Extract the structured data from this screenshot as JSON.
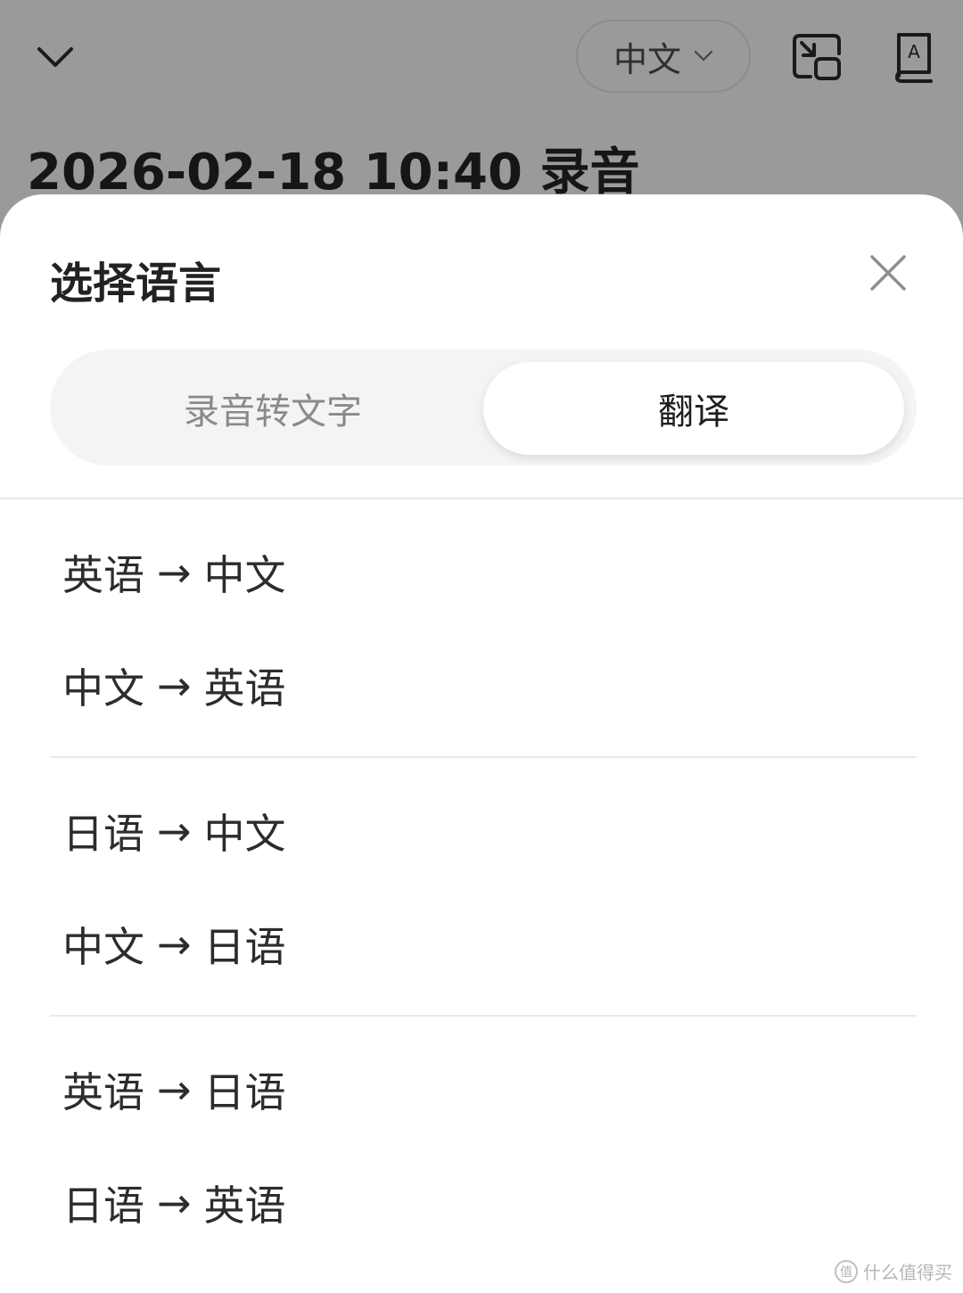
{
  "header": {
    "language_selector": "中文",
    "recording_title": "2026-02-18 10:40 录音"
  },
  "sheet": {
    "title": "选择语言",
    "tabs": [
      {
        "label": "录音转文字",
        "selected": false
      },
      {
        "label": "翻译",
        "selected": true
      }
    ],
    "arrow_glyph": "→",
    "groups": [
      {
        "items": [
          {
            "from": "英语",
            "to": "中文"
          },
          {
            "from": "中文",
            "to": "英语"
          }
        ]
      },
      {
        "items": [
          {
            "from": "日语",
            "to": "中文"
          },
          {
            "from": "中文",
            "to": "日语"
          }
        ]
      },
      {
        "items": [
          {
            "from": "英语",
            "to": "日语"
          },
          {
            "from": "日语",
            "to": "英语"
          }
        ]
      }
    ]
  },
  "watermark": {
    "icon_char": "值",
    "text": "什么值得买"
  },
  "icons": [
    "chevron-down-icon",
    "picture-in-picture-icon",
    "dictionary-icon",
    "close-icon"
  ],
  "colors": {
    "overlay": "#9a9a9a",
    "sheet": "#ffffff",
    "segment_bg": "#f4f4f5",
    "text_primary": "#2c2c2c",
    "text_muted": "#8a8a8c"
  }
}
